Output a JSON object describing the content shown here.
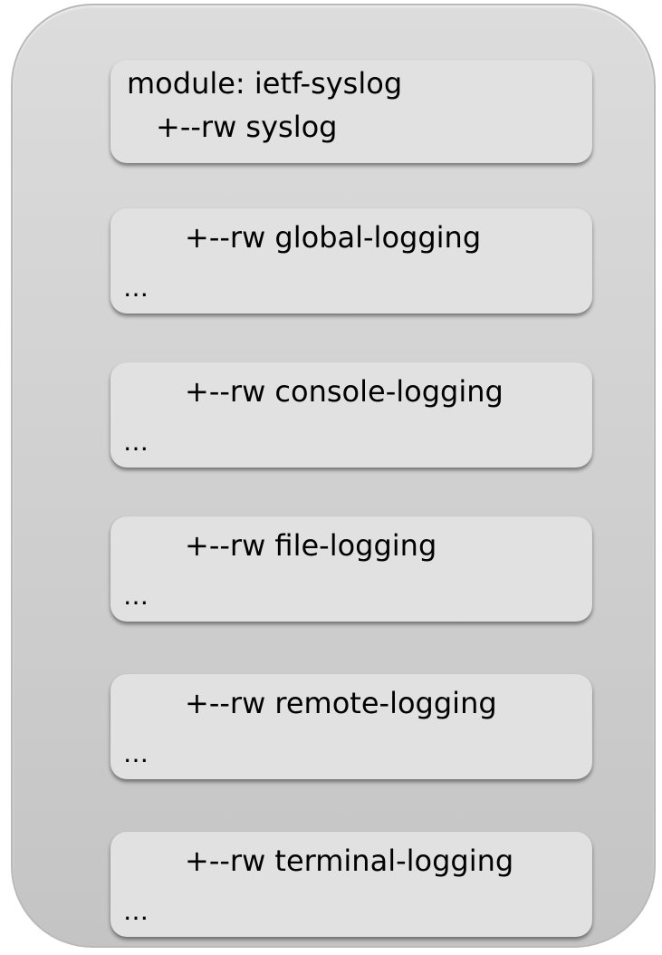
{
  "module_box": {
    "line1": "module: ietf-syslog",
    "line2": "+--rw syslog"
  },
  "containers": [
    {
      "label": "+--rw global-logging",
      "ellipsis": "…"
    },
    {
      "label": "+--rw console-logging",
      "ellipsis": "…"
    },
    {
      "label": "+--rw file-logging",
      "ellipsis": "…"
    },
    {
      "label": "+--rw remote-logging",
      "ellipsis": "…"
    },
    {
      "label": "+--rw terminal-logging",
      "ellipsis": "…"
    }
  ],
  "colors": {
    "outer_fill": "#d2d2d2",
    "box_fill": "#e1e1e1",
    "text": "#000000"
  }
}
